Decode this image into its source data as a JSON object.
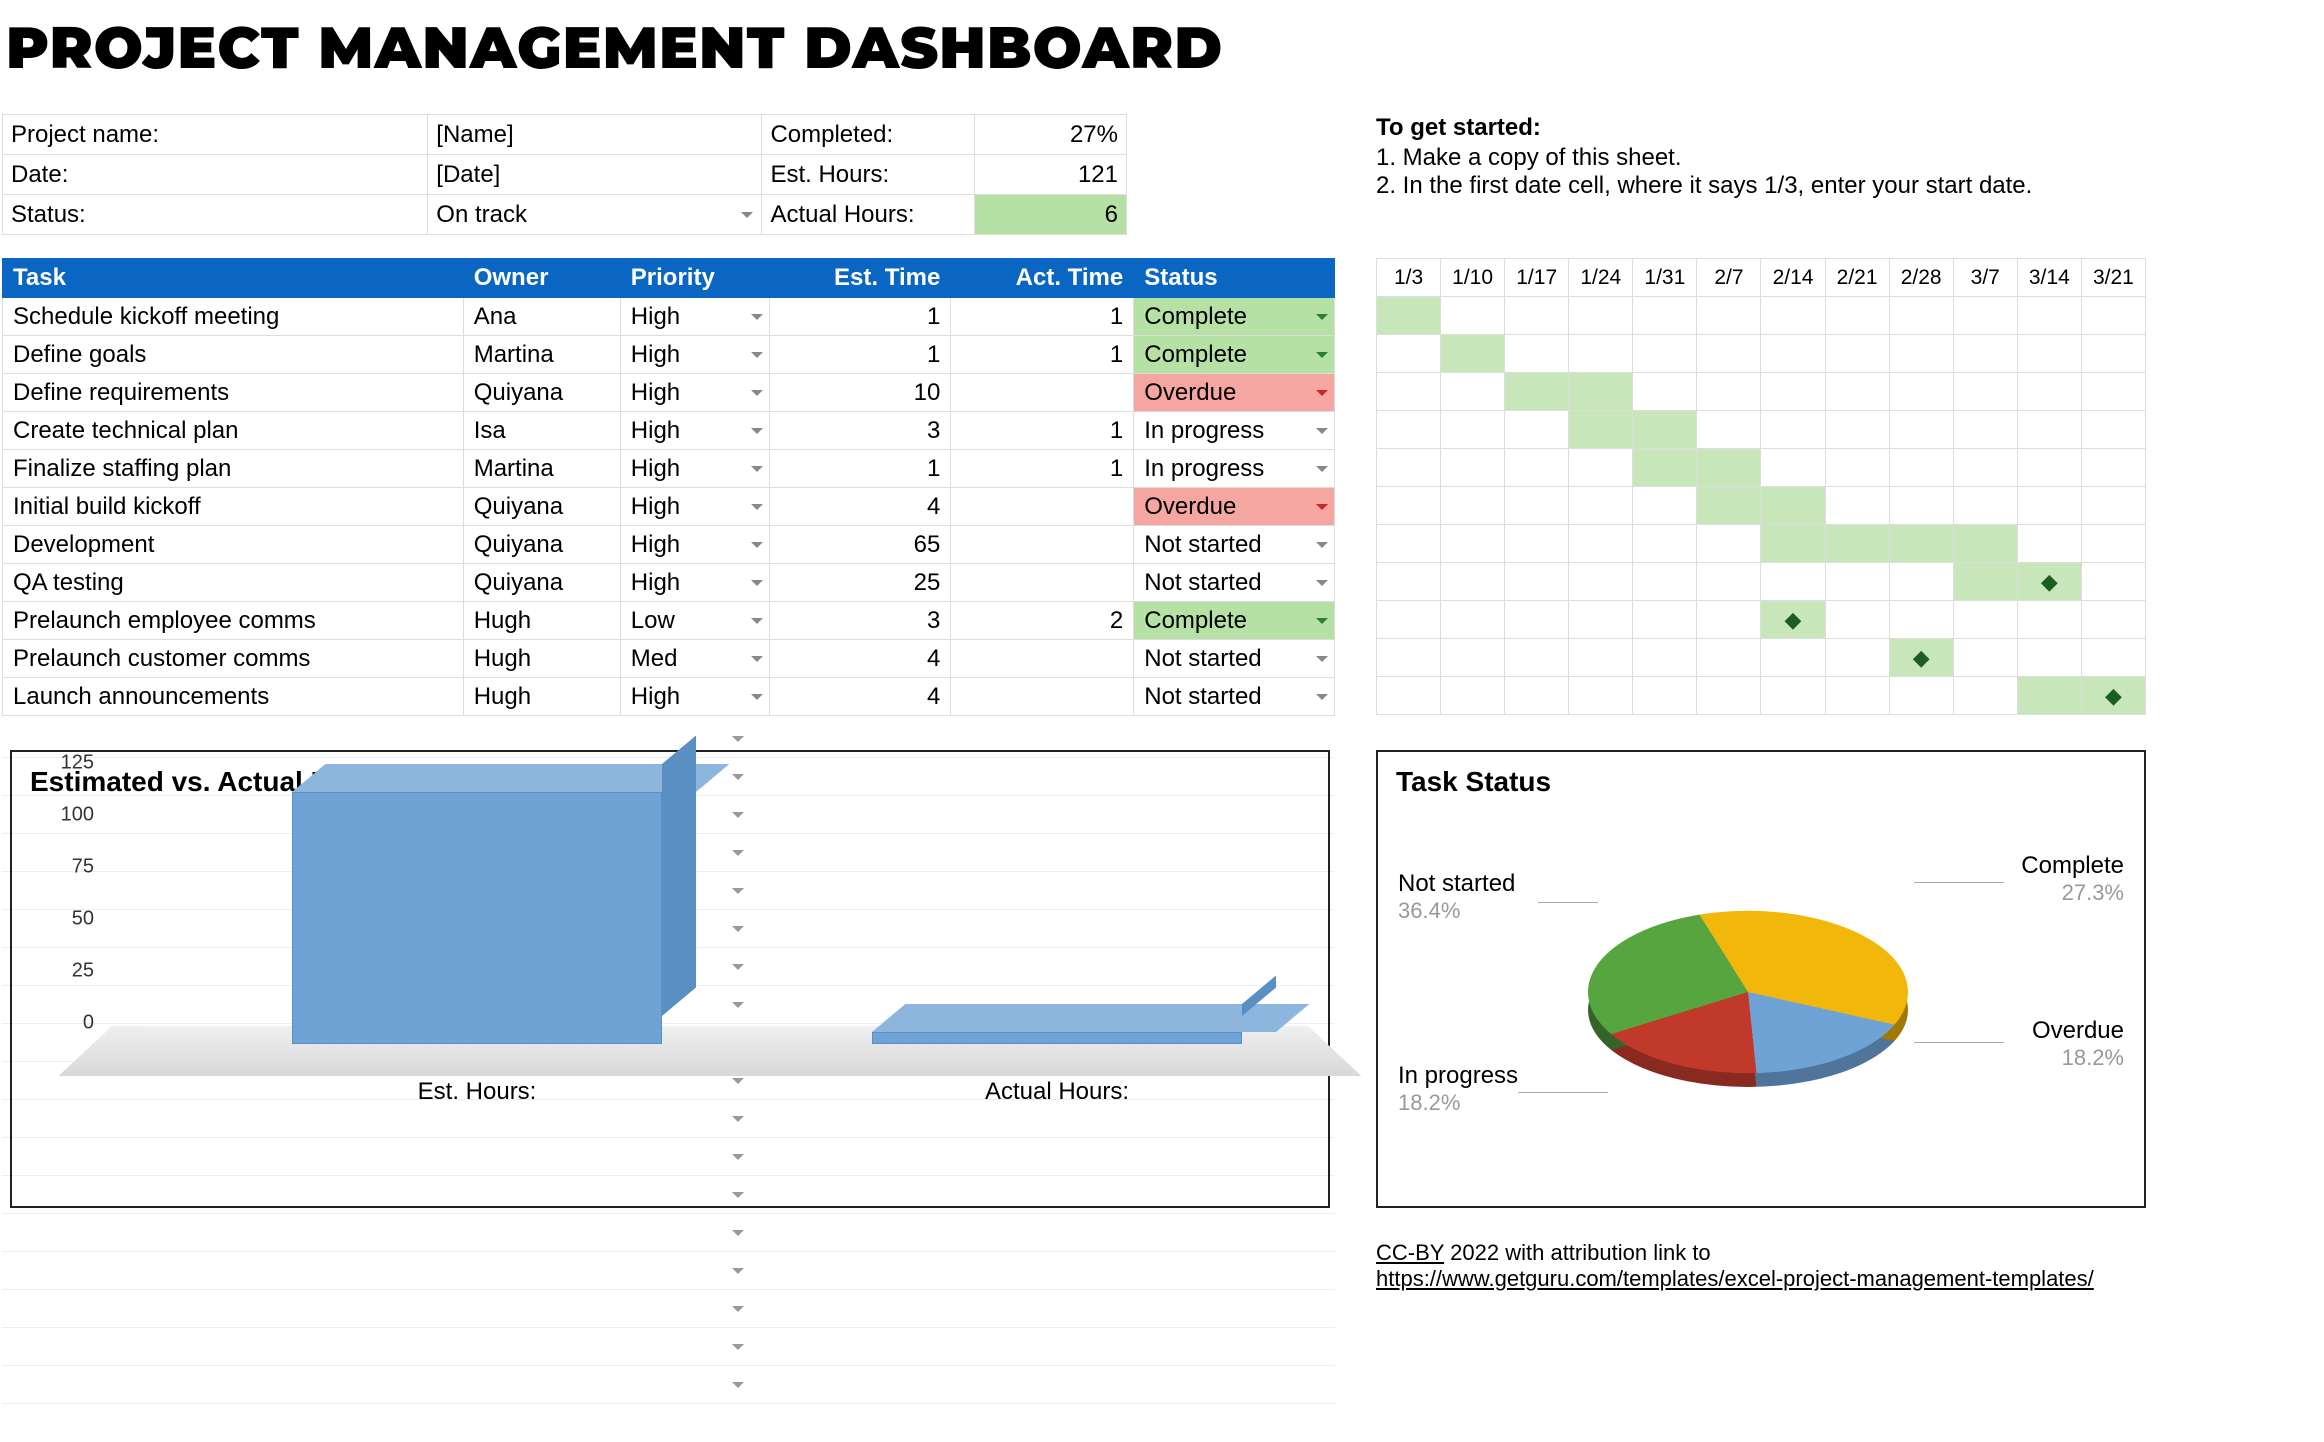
{
  "title": "PROJECT MANAGEMENT DASHBOARD",
  "meta": {
    "rows": [
      {
        "label": "Project name:",
        "value": "[Name]",
        "kpi_label": "Completed:",
        "kpi_value": "27%"
      },
      {
        "label": "Date:",
        "value": "[Date]",
        "kpi_label": "Est. Hours:",
        "kpi_value": "121"
      },
      {
        "label": "Status:",
        "value": "On track",
        "kpi_label": "Actual Hours:",
        "kpi_value": "6",
        "value_dd": true,
        "kpi_green": true
      }
    ]
  },
  "help": {
    "heading": "To get started:",
    "lines": [
      "1. Make a copy of this sheet.",
      "2. In the first date cell, where it says 1/3, enter your start date."
    ]
  },
  "tasks": {
    "headers": [
      "Task",
      "Owner",
      "Priority",
      "Est. Time",
      "Act. Time",
      "Status"
    ],
    "rows": [
      {
        "task": "Schedule kickoff meeting",
        "owner": "Ana",
        "priority": "High",
        "est": "1",
        "act": "1",
        "status": "Complete",
        "status_class": "complete"
      },
      {
        "task": "Define goals",
        "owner": "Martina",
        "priority": "High",
        "est": "1",
        "act": "1",
        "status": "Complete",
        "status_class": "complete"
      },
      {
        "task": "Define requirements",
        "owner": "Quiyana",
        "priority": "High",
        "est": "10",
        "act": "",
        "status": "Overdue",
        "status_class": "overdue"
      },
      {
        "task": "Create technical plan",
        "owner": "Isa",
        "priority": "High",
        "est": "3",
        "act": "1",
        "status": "In progress",
        "status_class": "none"
      },
      {
        "task": "Finalize staffing plan",
        "owner": "Martina",
        "priority": "High",
        "est": "1",
        "act": "1",
        "status": "In progress",
        "status_class": "none"
      },
      {
        "task": "Initial build kickoff",
        "owner": "Quiyana",
        "priority": "High",
        "est": "4",
        "act": "",
        "status": "Overdue",
        "status_class": "overdue"
      },
      {
        "task": "Development",
        "owner": "Quiyana",
        "priority": "High",
        "est": "65",
        "act": "",
        "status": "Not started",
        "status_class": "none"
      },
      {
        "task": "QA testing",
        "owner": "Quiyana",
        "priority": "High",
        "est": "25",
        "act": "",
        "status": "Not started",
        "status_class": "none"
      },
      {
        "task": "Prelaunch employee comms",
        "owner": "Hugh",
        "priority": "Low",
        "est": "3",
        "act": "2",
        "status": "Complete",
        "status_class": "complete"
      },
      {
        "task": "Prelaunch customer comms",
        "owner": "Hugh",
        "priority": "Med",
        "est": "4",
        "act": "",
        "status": "Not started",
        "status_class": "none"
      },
      {
        "task": "Launch announcements",
        "owner": "Hugh",
        "priority": "High",
        "est": "4",
        "act": "",
        "status": "Not started",
        "status_class": "none"
      }
    ]
  },
  "gantt": {
    "dates": [
      "1/3",
      "1/10",
      "1/17",
      "1/24",
      "1/31",
      "2/7",
      "2/14",
      "2/21",
      "2/28",
      "3/7",
      "3/14",
      "3/21"
    ],
    "rows": [
      {
        "fill": [
          0
        ],
        "diamond": []
      },
      {
        "fill": [
          1
        ],
        "diamond": []
      },
      {
        "fill": [
          2,
          3
        ],
        "diamond": []
      },
      {
        "fill": [
          3,
          4
        ],
        "diamond": []
      },
      {
        "fill": [
          4,
          5
        ],
        "diamond": []
      },
      {
        "fill": [
          5,
          6
        ],
        "diamond": []
      },
      {
        "fill": [
          6,
          7,
          8,
          9
        ],
        "diamond": []
      },
      {
        "fill": [
          9,
          10
        ],
        "diamond": [
          10
        ]
      },
      {
        "fill": [
          6
        ],
        "diamond": [
          6
        ]
      },
      {
        "fill": [
          8
        ],
        "diamond": [
          8
        ]
      },
      {
        "fill": [
          10,
          11
        ],
        "diamond": [
          11
        ]
      }
    ]
  },
  "attribution": {
    "line1_a": "CC-BY",
    "line1_b": " 2022 with attribution link to",
    "link": "https://www.getguru.com/templates/excel-project-management-templates/"
  },
  "chart_data": [
    {
      "type": "bar",
      "title": "Estimated vs. Actual Hours",
      "categories": [
        "Est. Hours:",
        "Actual Hours:"
      ],
      "values": [
        121,
        6
      ],
      "ylabel": "",
      "ylim": [
        0,
        125
      ],
      "yticks": [
        0,
        25,
        50,
        75,
        100,
        125
      ]
    },
    {
      "type": "pie",
      "title": "Task Status",
      "slices": [
        {
          "name": "Not started",
          "value": 36.4,
          "color": "#f1b70b"
        },
        {
          "name": "In progress",
          "value": 18.2,
          "color": "#6fa3d6"
        },
        {
          "name": "Overdue",
          "value": 18.2,
          "color": "#c0392b"
        },
        {
          "name": "Complete",
          "value": 27.3,
          "color": "#57a53f"
        }
      ]
    }
  ]
}
